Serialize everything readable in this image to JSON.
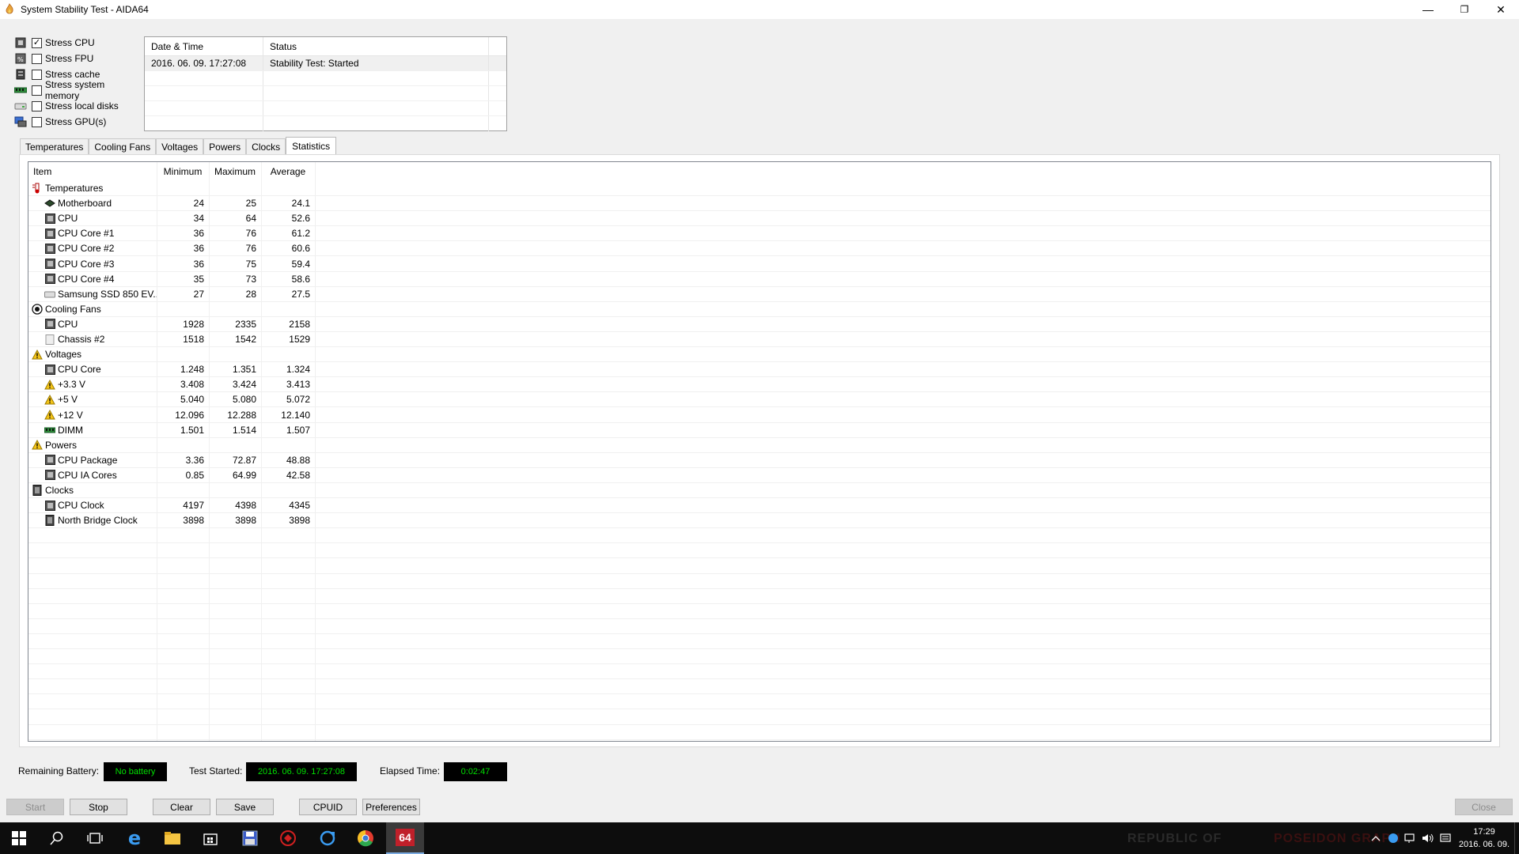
{
  "window": {
    "title": "System Stability Test - AIDA64",
    "minimize": "—",
    "restore": "❐",
    "close": "✕"
  },
  "stress": [
    {
      "label": "Stress CPU",
      "checked": true,
      "icon": "cpu-icon"
    },
    {
      "label": "Stress FPU",
      "checked": false,
      "icon": "fpu-icon"
    },
    {
      "label": "Stress cache",
      "checked": false,
      "icon": "cache-icon"
    },
    {
      "label": "Stress system memory",
      "checked": false,
      "icon": "memory-icon"
    },
    {
      "label": "Stress local disks",
      "checked": false,
      "icon": "disk-icon"
    },
    {
      "label": "Stress GPU(s)",
      "checked": false,
      "icon": "gpu-icon"
    }
  ],
  "log": {
    "headers": [
      "Date & Time",
      "Status"
    ],
    "rows": [
      {
        "datetime": "2016. 06. 09. 17:27:08",
        "status": "Stability Test: Started"
      }
    ]
  },
  "tabs": [
    "Temperatures",
    "Cooling Fans",
    "Voltages",
    "Powers",
    "Clocks",
    "Statistics"
  ],
  "active_tab": "Statistics",
  "stats": {
    "headers": {
      "item": "Item",
      "min": "Minimum",
      "max": "Maximum",
      "avg": "Average"
    },
    "rows": [
      {
        "type": "group",
        "label": "Temperatures",
        "icon": "thermometer-icon"
      },
      {
        "type": "item",
        "label": "Motherboard",
        "icon": "motherboard-icon",
        "min": "24",
        "max": "25",
        "avg": "24.1"
      },
      {
        "type": "item",
        "label": "CPU",
        "icon": "chip-icon",
        "min": "34",
        "max": "64",
        "avg": "52.6"
      },
      {
        "type": "item",
        "label": "CPU Core #1",
        "icon": "chip-icon",
        "min": "36",
        "max": "76",
        "avg": "61.2"
      },
      {
        "type": "item",
        "label": "CPU Core #2",
        "icon": "chip-icon",
        "min": "36",
        "max": "76",
        "avg": "60.6"
      },
      {
        "type": "item",
        "label": "CPU Core #3",
        "icon": "chip-icon",
        "min": "36",
        "max": "75",
        "avg": "59.4"
      },
      {
        "type": "item",
        "label": "CPU Core #4",
        "icon": "chip-icon",
        "min": "35",
        "max": "73",
        "avg": "58.6"
      },
      {
        "type": "item",
        "label": "Samsung SSD 850 EV...",
        "icon": "ssd-icon",
        "min": "27",
        "max": "28",
        "avg": "27.5"
      },
      {
        "type": "group",
        "label": "Cooling Fans",
        "icon": "fan-icon"
      },
      {
        "type": "item",
        "label": "CPU",
        "icon": "chip-icon",
        "min": "1928",
        "max": "2335",
        "avg": "2158"
      },
      {
        "type": "item",
        "label": "Chassis #2",
        "icon": "chassis-icon",
        "min": "1518",
        "max": "1542",
        "avg": "1529"
      },
      {
        "type": "group",
        "label": "Voltages",
        "icon": "warning-icon"
      },
      {
        "type": "item",
        "label": "CPU Core",
        "icon": "chip-icon",
        "min": "1.248",
        "max": "1.351",
        "avg": "1.324"
      },
      {
        "type": "item",
        "label": "+3.3 V",
        "icon": "warning-icon",
        "min": "3.408",
        "max": "3.424",
        "avg": "3.413"
      },
      {
        "type": "item",
        "label": "+5 V",
        "icon": "warning-icon",
        "min": "5.040",
        "max": "5.080",
        "avg": "5.072"
      },
      {
        "type": "item",
        "label": "+12 V",
        "icon": "warning-icon",
        "min": "12.096",
        "max": "12.288",
        "avg": "12.140"
      },
      {
        "type": "item",
        "label": "DIMM",
        "icon": "memory-icon",
        "min": "1.501",
        "max": "1.514",
        "avg": "1.507"
      },
      {
        "type": "group",
        "label": "Powers",
        "icon": "warning-icon"
      },
      {
        "type": "item",
        "label": "CPU Package",
        "icon": "chip-icon",
        "min": "3.36",
        "max": "72.87",
        "avg": "48.88"
      },
      {
        "type": "item",
        "label": "CPU IA Cores",
        "icon": "chip-icon",
        "min": "0.85",
        "max": "64.99",
        "avg": "42.58"
      },
      {
        "type": "group",
        "label": "Clocks",
        "icon": "clock-chip-icon"
      },
      {
        "type": "item",
        "label": "CPU Clock",
        "icon": "chip-icon",
        "min": "4197",
        "max": "4398",
        "avg": "4345"
      },
      {
        "type": "item",
        "label": "North Bridge Clock",
        "icon": "northbridge-icon",
        "min": "3898",
        "max": "3898",
        "avg": "3898"
      }
    ]
  },
  "info": {
    "battery_label": "Remaining Battery:",
    "battery_value": "No battery",
    "started_label": "Test Started:",
    "started_value": "2016. 06. 09. 17:27:08",
    "elapsed_label": "Elapsed Time:",
    "elapsed_value": "0:02:47"
  },
  "buttons": {
    "start": "Start",
    "stop": "Stop",
    "clear": "Clear",
    "save": "Save",
    "cpuid": "CPUID",
    "preferences": "Preferences",
    "close": "Close"
  },
  "taskbar": {
    "brand_left": "REPUBLIC OF",
    "brand_right": "POSEIDON GRAPH",
    "time": "17:29",
    "date": "2016. 06. 09.",
    "active_app_label": "64"
  },
  "colors": {
    "lcd_text": "#00e000",
    "lcd_bg": "#000000",
    "taskbar_bg": "#0d0d0d"
  }
}
